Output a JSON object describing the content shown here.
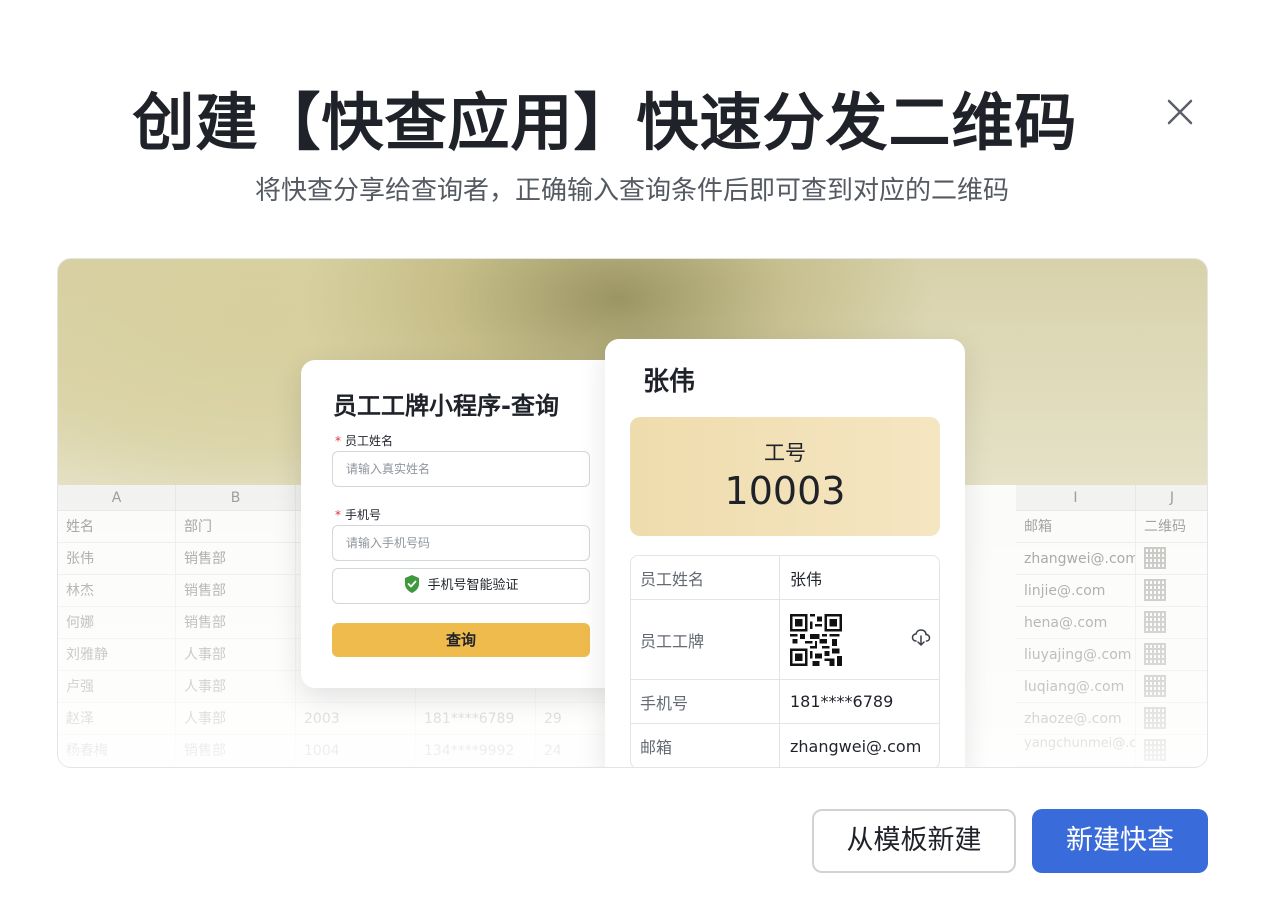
{
  "dialog": {
    "title": "创建【快查应用】快速分发二维码",
    "subtitle": "将快查分享给查询者，正确输入查询条件后即可查到对应的二维码",
    "close_icon": "close-icon"
  },
  "spreadsheet": {
    "columns": [
      {
        "letter": "A",
        "header": "姓名"
      },
      {
        "letter": "B",
        "header": "部门"
      },
      {
        "letter": "",
        "header": ""
      },
      {
        "letter": "",
        "header": ""
      },
      {
        "letter": "",
        "header": ""
      },
      {
        "letter": "I",
        "header": "邮箱"
      },
      {
        "letter": "J",
        "header": "二维码"
      }
    ],
    "rows": [
      {
        "name": "张伟",
        "dept": "销售部",
        "c": "",
        "d": "",
        "e": "",
        "email": "zhangwei@.com"
      },
      {
        "name": "林杰",
        "dept": "销售部",
        "c": "",
        "d": "",
        "e": "",
        "email": "linjie@.com"
      },
      {
        "name": "何娜",
        "dept": "销售部",
        "c": "",
        "d": "",
        "e": "",
        "email": "hena@.com"
      },
      {
        "name": "刘雅静",
        "dept": "人事部",
        "c": "",
        "d": "",
        "e": "",
        "email": "liuyajing@.com"
      },
      {
        "name": "卢强",
        "dept": "人事部",
        "c": "",
        "d": "",
        "e": "",
        "email": "luqiang@.com"
      },
      {
        "name": "赵泽",
        "dept": "人事部",
        "c": "2003",
        "d": "181****6789",
        "e": "29",
        "email": "zhaoze@.com"
      },
      {
        "name": "杨春梅",
        "dept": "销售部",
        "c": "1004",
        "d": "134****9992",
        "e": "24",
        "email": "yangchunmei@.com"
      }
    ]
  },
  "form_card": {
    "title": "员工工牌小程序-查询",
    "name_label": "员工姓名",
    "name_placeholder": "请输入真实姓名",
    "phone_label": "手机号",
    "phone_placeholder": "请输入手机号码",
    "verify_label": "手机号智能验证",
    "query_button": "查询",
    "required_mark": "*",
    "accent_color": "#efbb4d"
  },
  "result_card": {
    "name": "张伟",
    "badge_label": "工号",
    "badge_value": "10003",
    "rows": [
      {
        "key": "员工姓名",
        "value": "张伟"
      },
      {
        "key": "员工工牌",
        "value": ""
      },
      {
        "key": "手机号",
        "value": "181****6789"
      },
      {
        "key": "邮箱",
        "value": "zhangwei@.com"
      }
    ]
  },
  "footer": {
    "template_button": "从模板新建",
    "new_button": "新建快查",
    "primary_color": "#3a6bdb"
  }
}
